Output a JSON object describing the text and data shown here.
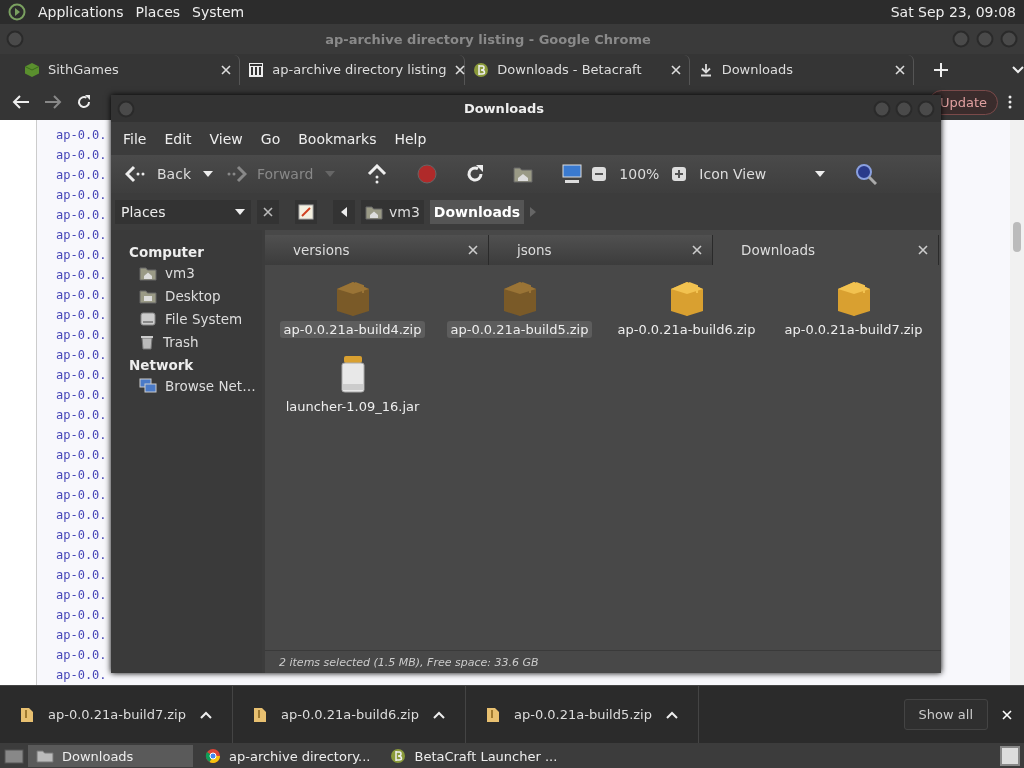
{
  "top_panel": {
    "menus": [
      "Applications",
      "Places",
      "System"
    ],
    "clock": "Sat Sep 23, 09:08"
  },
  "browser": {
    "title": "ap-archive directory listing - Google Chrome",
    "tabs": [
      {
        "label": "SithGames",
        "kind": "cube"
      },
      {
        "label": "ap-archive directory listing",
        "kind": "archive"
      },
      {
        "label": "Downloads - Betacraft",
        "kind": "beta"
      },
      {
        "label": "Downloads",
        "kind": "download"
      }
    ],
    "update_button": "Update",
    "page_lines": [
      "ap-0.0.",
      "ap-0.0.",
      "ap-0.0.",
      "ap-0.0.",
      "ap-0.0.",
      "ap-0.0.",
      "ap-0.0.",
      "ap-0.0.",
      "ap-0.0.",
      "ap-0.0.",
      "ap-0.0.",
      "ap-0.0.",
      "ap-0.0.",
      "ap-0.0.",
      "ap-0.0.",
      "ap-0.0.",
      "ap-0.0.",
      "ap-0.0.",
      "ap-0.0.",
      "ap-0.0.",
      "ap-0.0.",
      "ap-0.0.",
      "ap-0.0.",
      "ap-0.0.",
      "ap-0.0.",
      "ap-0.0.",
      "ap-0.0.",
      "ap-0.0."
    ]
  },
  "file_manager": {
    "title": "Downloads",
    "menus": [
      "File",
      "Edit",
      "View",
      "Go",
      "Bookmarks",
      "Help"
    ],
    "toolbar": {
      "back": "Back",
      "forward": "Forward",
      "forward_disabled": true,
      "zoom": "100%",
      "view": "Icon View"
    },
    "sidebar": {
      "selector": "Places",
      "sections": [
        {
          "heading": "Computer",
          "items": [
            {
              "label": "vm3",
              "kind": "home"
            },
            {
              "label": "Desktop",
              "kind": "desktop"
            },
            {
              "label": "File System",
              "kind": "drive"
            },
            {
              "label": "Trash",
              "kind": "trash"
            }
          ]
        },
        {
          "heading": "Network",
          "items": [
            {
              "label": "Browse Net…",
              "kind": "network"
            }
          ]
        }
      ]
    },
    "path": [
      {
        "label": "vm3",
        "selected": false
      },
      {
        "label": "Downloads",
        "selected": true
      }
    ],
    "tabs": [
      {
        "label": "versions",
        "selected": false
      },
      {
        "label": "jsons",
        "selected": false
      },
      {
        "label": "Downloads",
        "selected": true
      }
    ],
    "files": [
      {
        "name": "ap-0.0.21a-build4.zip",
        "kind": "zip",
        "selected": true
      },
      {
        "name": "ap-0.0.21a-build5.zip",
        "kind": "zip",
        "selected": true
      },
      {
        "name": "ap-0.0.21a-build6.zip",
        "kind": "zip",
        "selected": false
      },
      {
        "name": "ap-0.0.21a-build7.zip",
        "kind": "zip",
        "selected": false
      },
      {
        "name": "launcher-1.09_16.jar",
        "kind": "jar",
        "selected": false
      }
    ],
    "status": "2 items selected (1.5 MB), Free space: 33.6 GB"
  },
  "downloads_bar": {
    "items": [
      "ap-0.0.21a-build7.zip",
      "ap-0.0.21a-build6.zip",
      "ap-0.0.21a-build5.zip"
    ],
    "show_all": "Show all"
  },
  "taskbar": {
    "items": [
      {
        "label": "Downloads",
        "kind": "folder",
        "selected": true
      },
      {
        "label": "ap-archive directory...",
        "kind": "chrome",
        "selected": false
      },
      {
        "label": "BetaCraft Launcher ...",
        "kind": "beta",
        "selected": false
      }
    ]
  }
}
